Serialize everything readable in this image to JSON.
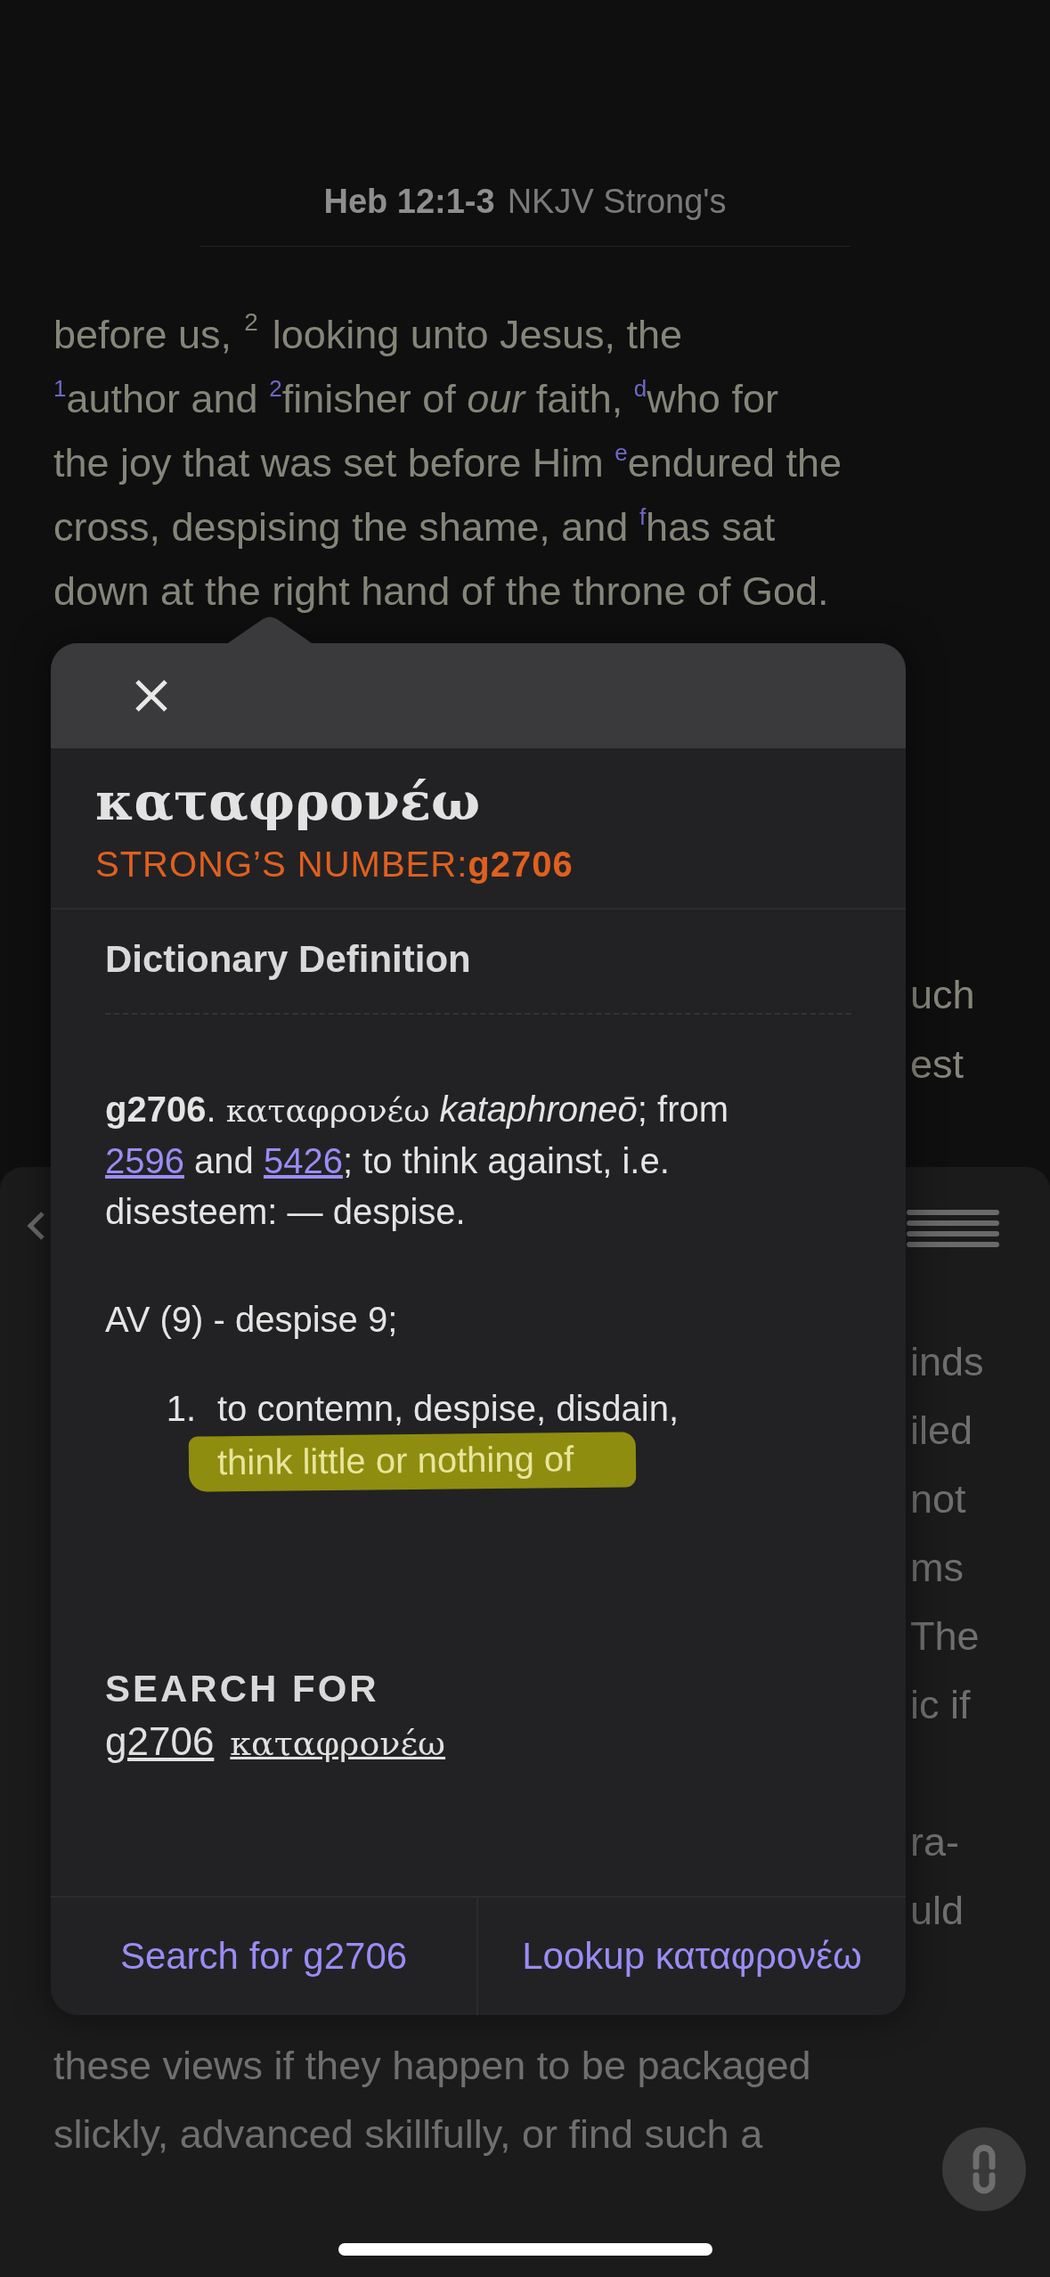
{
  "header": {
    "reference": "Heb 12:1-3",
    "version": "NKJV Strong's"
  },
  "passage": {
    "lines": [
      {
        "text": "before us,",
        "verse": "2",
        "rest": "looking unto Jesus, the"
      },
      {
        "text": "$^{1}$author and $^{2}$finisher of *our* faith, $^{d}$who for"
      },
      {
        "text": "the joy that was set before Him $^{e}$endured the"
      },
      {
        "text": "cross, despising the shame, and $^{f}$has sat"
      },
      {
        "text": "down at the right hand of the throne of God."
      }
    ],
    "cut_lines": [
      "uch",
      "est"
    ]
  },
  "lower_panel": {
    "cut_lines": [
      "inds",
      "iled",
      "not",
      "ms",
      "The",
      "ic if",
      "ra-",
      "uld"
    ],
    "lines": [
      "these views if they happen to be packaged",
      "slickly, advanced skillfully, or find such a"
    ]
  },
  "popup": {
    "headword": "καταφρονέω",
    "strongs_label": "STRONG’S NUMBER:",
    "strongs_number": "g2706",
    "section_title": "Dictionary Definition",
    "definition": [
      {
        "kind": "bold",
        "text": "g2706"
      },
      {
        "kind": "plain",
        "text": ". "
      },
      {
        "kind": "greek",
        "text": "καταφρονέω"
      },
      {
        "kind": "italic",
        "text": "kataphroneō"
      },
      {
        "kind": "plain",
        "text": "; from "
      },
      {
        "kind": "link",
        "text": "2596"
      },
      {
        "kind": "plain",
        "text": " and "
      },
      {
        "kind": "link",
        "text": "5426"
      },
      {
        "kind": "plain",
        "text": "; to think against, i.e. disesteem: — despise."
      }
    ],
    "usage": "AV (9) - despise 9;",
    "senses": [
      {
        "number": "1.",
        "text": "to contemn, despise, disdain,",
        "highlighted_text": "think little or nothing of"
      }
    ],
    "search_title": "SEARCH FOR",
    "search_links": [
      {
        "kind": "plain",
        "text": "g2706"
      },
      {
        "kind": "greek",
        "text": "καταφρονέω"
      }
    ],
    "actions": [
      "Search for g2706",
      "Lookup καταφρονέω"
    ]
  }
}
